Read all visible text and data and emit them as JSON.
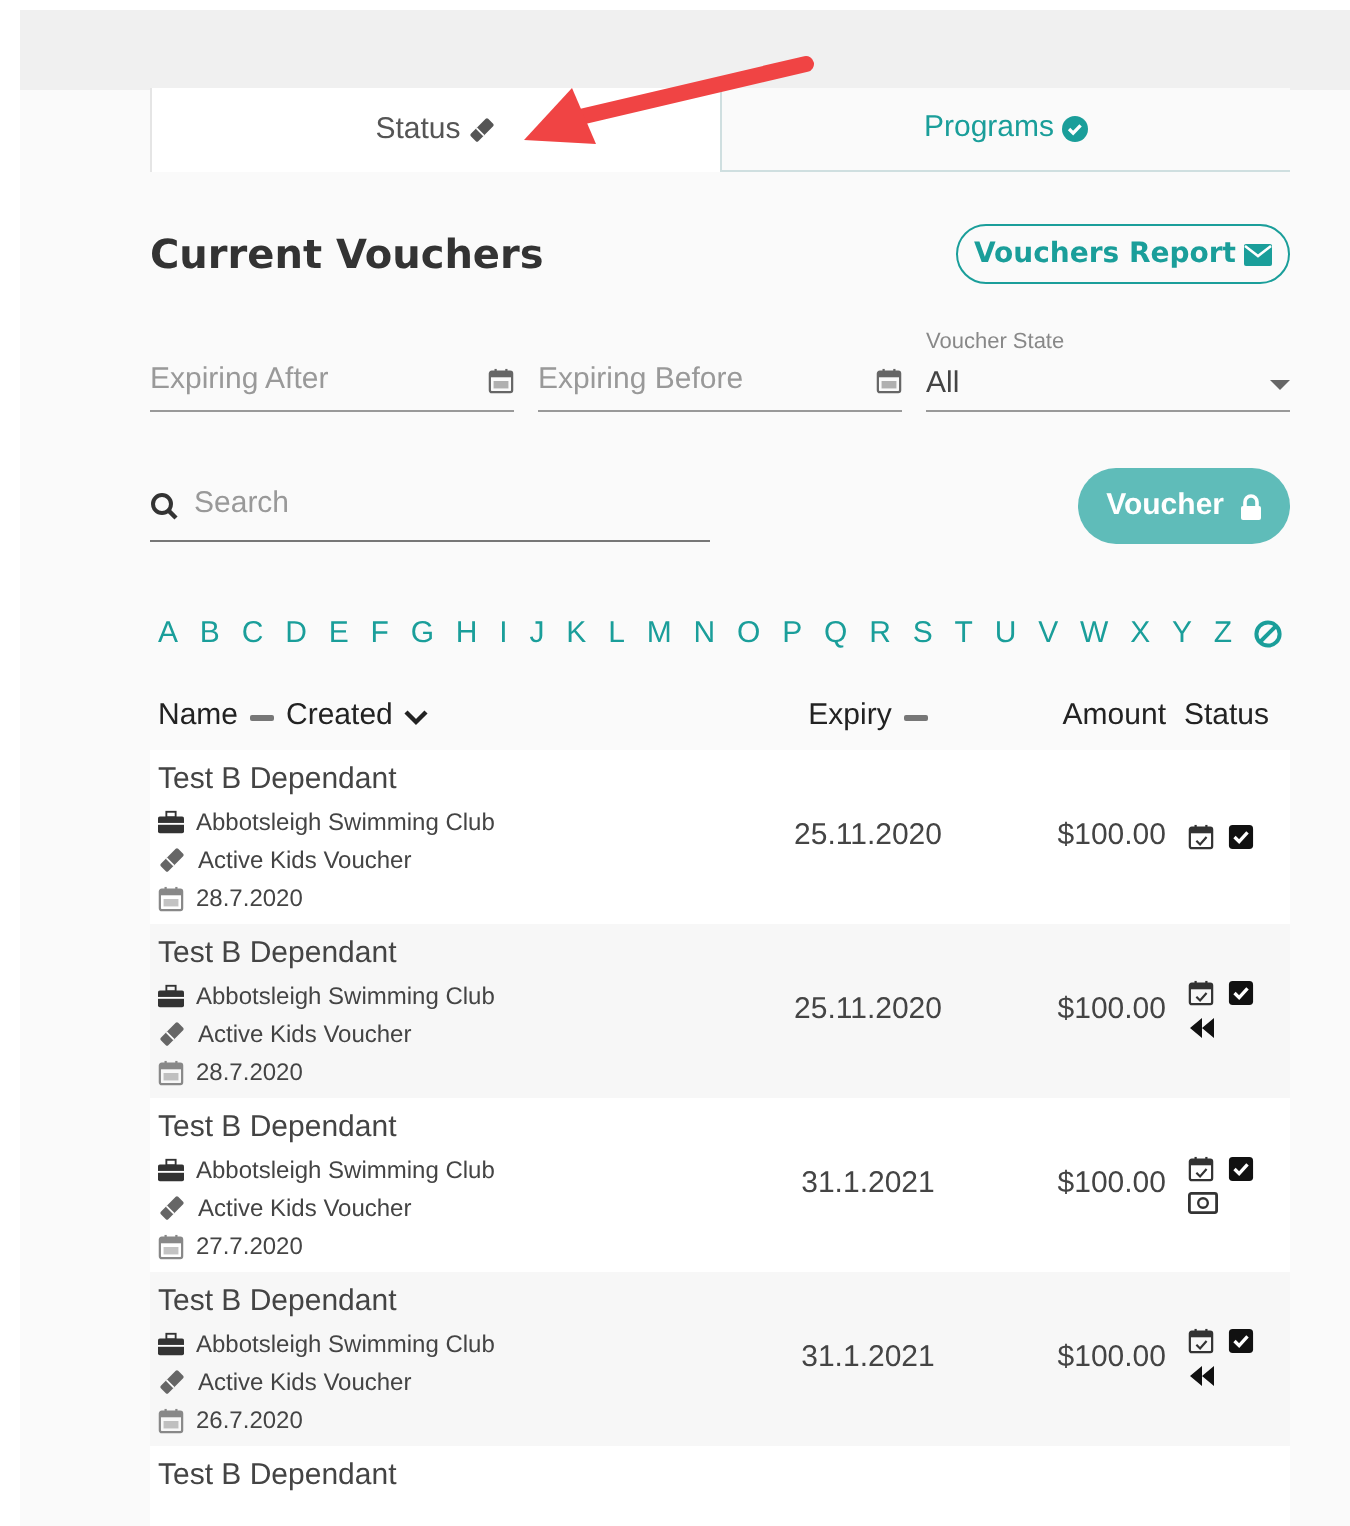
{
  "tabs": [
    {
      "label": "Status",
      "selected": true
    },
    {
      "label": "Programs",
      "selected": false
    }
  ],
  "title": "Current Vouchers",
  "report_button": "Vouchers Report",
  "filters": {
    "expiring_after": {
      "placeholder": "Expiring After"
    },
    "expiring_before": {
      "placeholder": "Expiring Before"
    },
    "voucher_state": {
      "label": "Voucher State",
      "value": "All"
    }
  },
  "search": {
    "placeholder": "Search"
  },
  "voucher_button": "Voucher",
  "letters": [
    "A",
    "B",
    "C",
    "D",
    "E",
    "F",
    "G",
    "H",
    "I",
    "J",
    "K",
    "L",
    "M",
    "N",
    "O",
    "P",
    "Q",
    "R",
    "S",
    "T",
    "U",
    "V",
    "W",
    "X",
    "Y",
    "Z"
  ],
  "columns": {
    "name": "Name",
    "created": "Created",
    "expiry": "Expiry",
    "amount": "Amount",
    "status": "Status"
  },
  "rows": [
    {
      "name": "Test B Dependant",
      "club": "Abbotsleigh Swimming Club",
      "voucher": "Active Kids Voucher",
      "created": "28.7.2020",
      "expiry": "25.11.2020",
      "amount": "$100.00",
      "status_icons": [
        {
          "kind": "calendar"
        },
        {
          "kind": "checkbox"
        }
      ]
    },
    {
      "name": "Test B Dependant",
      "club": "Abbotsleigh Swimming Club",
      "voucher": "Active Kids Voucher",
      "created": "28.7.2020",
      "expiry": "25.11.2020",
      "amount": "$100.00",
      "status_icons": [
        {
          "kind": "calendar"
        },
        {
          "kind": "checkbox"
        },
        {
          "kind": "rewind"
        }
      ]
    },
    {
      "name": "Test B Dependant",
      "club": "Abbotsleigh Swimming Club",
      "voucher": "Active Kids Voucher",
      "created": "27.7.2020",
      "expiry": "31.1.2021",
      "amount": "$100.00",
      "status_icons": [
        {
          "kind": "calendar"
        },
        {
          "kind": "checkbox"
        },
        {
          "kind": "money"
        }
      ]
    },
    {
      "name": "Test B Dependant",
      "club": "Abbotsleigh Swimming Club",
      "voucher": "Active Kids Voucher",
      "created": "26.7.2020",
      "expiry": "31.1.2021",
      "amount": "$100.00",
      "status_icons": [
        {
          "kind": "calendar"
        },
        {
          "kind": "checkbox"
        },
        {
          "kind": "rewind"
        }
      ]
    },
    {
      "name": "Test B Dependant"
    }
  ]
}
